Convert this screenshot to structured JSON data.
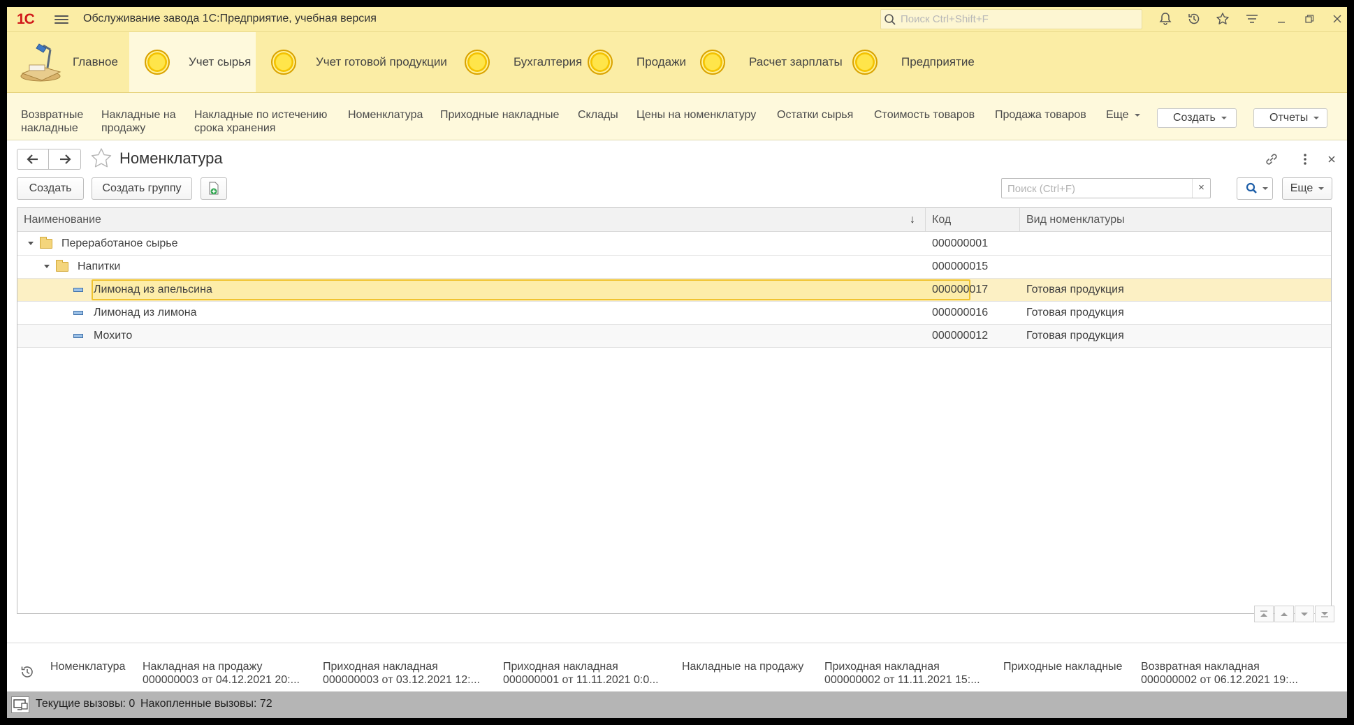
{
  "app": {
    "logo_text": "1С",
    "title": "Обслуживание завода 1С:Предприятие, учебная версия",
    "search_placeholder": "Поиск Ctrl+Shift+F"
  },
  "titlebar_icons": [
    "bell-icon",
    "history-icon",
    "star-icon",
    "settings-list-icon",
    "minimize-icon",
    "restore-icon",
    "close-icon"
  ],
  "sections": [
    {
      "label": "Главное",
      "icon": "home-icon"
    },
    {
      "label": "Учет сырья",
      "icon": "coin-icon",
      "active": true
    },
    {
      "label": "Учет готовой продукции",
      "icon": "coin-icon"
    },
    {
      "label": "Бухгалтерия",
      "icon": "coin-icon"
    },
    {
      "label": "Продажи",
      "icon": "coin-icon"
    },
    {
      "label": "Расчет зарплаты",
      "icon": "coin-icon"
    },
    {
      "label": "Предприятие",
      "icon": "coin-icon"
    }
  ],
  "commands": [
    {
      "line1": "Возвратные",
      "line2": "накладные"
    },
    {
      "line1": "Накладные на",
      "line2": "продажу"
    },
    {
      "line1": "Накладные по истечению",
      "line2": "срока хранения"
    },
    {
      "line1": "Номенклатура",
      "line2": ""
    },
    {
      "line1": "Приходные накладные",
      "line2": ""
    },
    {
      "line1": "Склады",
      "line2": ""
    },
    {
      "line1": "Цены на номенклатуру",
      "line2": ""
    },
    {
      "line1": "Остатки сырья",
      "line2": ""
    },
    {
      "line1": "Стоимость товаров",
      "line2": ""
    },
    {
      "line1": "Продажа товаров",
      "line2": ""
    }
  ],
  "command_more": "Еще",
  "command_create": "Создать",
  "command_reports": "Отчеты",
  "form": {
    "title": "Номенклатура",
    "create": "Создать",
    "create_group": "Создать группу",
    "search_placeholder": "Поиск (Ctrl+F)",
    "clear": "×",
    "more": "Еще"
  },
  "table": {
    "columns": [
      "Наименование",
      "Код",
      "Вид номенклатуры"
    ],
    "sort_indicator": "↓",
    "rows": [
      {
        "name": "Переработаное сырье",
        "code": "000000001",
        "kind": "",
        "type": "folder",
        "level": 0
      },
      {
        "name": "Напитки",
        "code": "000000015",
        "kind": "",
        "type": "folder",
        "level": 1
      },
      {
        "name": "Лимонад из апельсина",
        "code": "000000017",
        "kind": "Готовая продукция",
        "type": "item",
        "level": 2,
        "selected": true
      },
      {
        "name": "Лимонад из лимона",
        "code": "000000016",
        "kind": "Готовая продукция",
        "type": "item",
        "level": 2
      },
      {
        "name": "Мохито",
        "code": "000000012",
        "kind": "Готовая продукция",
        "type": "item",
        "level": 2
      }
    ]
  },
  "history": [
    {
      "line1": "Номенклатура",
      "line2": ""
    },
    {
      "line1": "Накладная на продажу",
      "line2": "000000003 от 04.12.2021 20:..."
    },
    {
      "line1": "Приходная накладная",
      "line2": "000000003 от 03.12.2021 12:..."
    },
    {
      "line1": "Приходная накладная",
      "line2": "000000001 от 11.11.2021 0:0..."
    },
    {
      "line1": "Накладные на продажу",
      "line2": ""
    },
    {
      "line1": "Приходная накладная",
      "line2": "000000002 от 11.11.2021 15:..."
    },
    {
      "line1": "Приходные накладные",
      "line2": ""
    },
    {
      "line1": "Возвратная накладная",
      "line2": "000000002 от 06.12.2021 19:..."
    }
  ],
  "status": {
    "current_calls": "Текущие вызовы: 0",
    "accumulated_calls": "Накопленные вызовы: 72"
  },
  "colors": {
    "header_bg": "#fbeda5",
    "command_bg": "#fef9dc",
    "selection": "#f0c330",
    "logo": "#d0191a"
  }
}
